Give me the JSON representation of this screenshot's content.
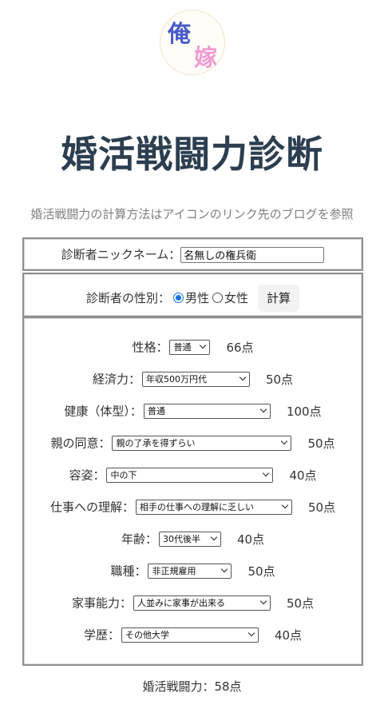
{
  "logo": {
    "char1": "俺",
    "char2": "嫁"
  },
  "title": "婚活戦闘力診断",
  "subtitle": "婚活戦闘力の計算方法はアイコンのリンク先のブログを参照",
  "nickname": {
    "label": "診断者ニックネーム：",
    "value": "名無しの権兵衛"
  },
  "gender": {
    "label": "診断者の性別：",
    "options": [
      "男性",
      "女性"
    ],
    "selected": "男性",
    "calc_button": "計算"
  },
  "factors": [
    {
      "label": "性格：",
      "value": "普通",
      "points": "66点"
    },
    {
      "label": "経済力：",
      "value": "年収500万円代",
      "points": "50点"
    },
    {
      "label": "健康（体型）：",
      "value": "普通",
      "points": "100点"
    },
    {
      "label": "親の同意：",
      "value": "親の了承を得ずらい",
      "points": "50点"
    },
    {
      "label": "容姿：",
      "value": "中の下",
      "points": "40点"
    },
    {
      "label": "仕事への理解：",
      "value": "相手の仕事への理解に乏しい",
      "points": "50点"
    },
    {
      "label": "年齢：",
      "value": "30代後半",
      "points": "40点"
    },
    {
      "label": "職種：",
      "value": "非正規雇用",
      "points": "50点"
    },
    {
      "label": "家事能力：",
      "value": "人並みに家事が出来る",
      "points": "50点"
    },
    {
      "label": "学歴：",
      "value": "その他大学",
      "points": "40点"
    }
  ],
  "result": "婚活戦闘力：58点",
  "colors": {
    "title": "#2c3e50",
    "logo_char1": "#4a5cc8",
    "logo_char2": "#f19ad2",
    "radio_accent": "#1a73e8",
    "box_border": "#8f8f8f"
  }
}
